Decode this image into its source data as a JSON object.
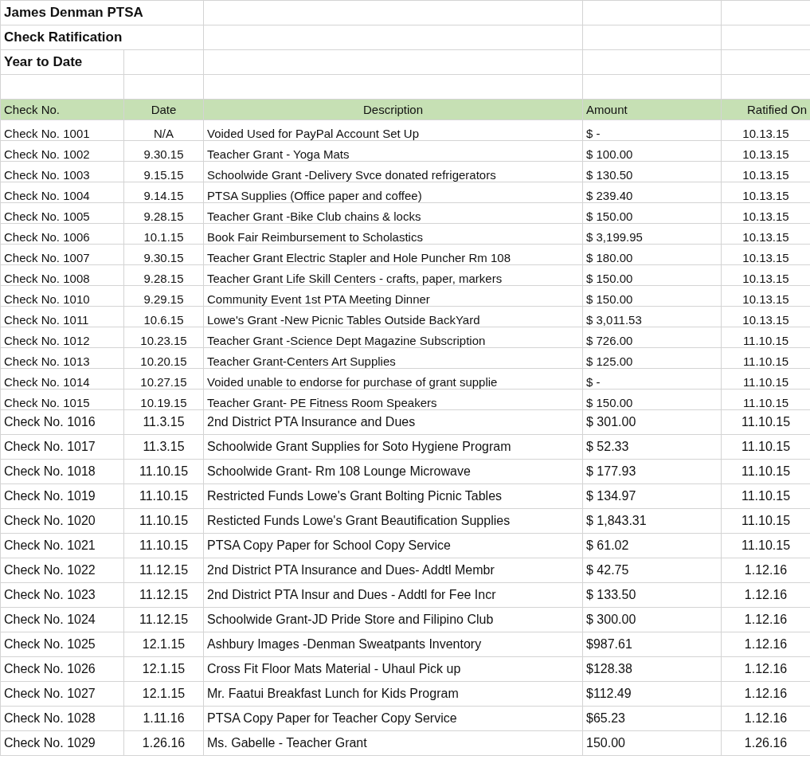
{
  "title_lines": [
    "James Denman PTSA",
    "Check Ratification",
    "Year to Date"
  ],
  "columns": [
    "Check No.",
    "Date",
    "Description",
    "Amount",
    "Ratified On"
  ],
  "rows": [
    {
      "check_no": "Check No. 1001",
      "date": "N/A",
      "description": "Voided  Used for PayPal Account Set Up",
      "amount": "$ -",
      "ratified_on": "10.13.15"
    },
    {
      "check_no": "Check No. 1002",
      "date": "9.30.15",
      "description": "Teacher Grant - Yoga Mats",
      "amount": "$ 100.00",
      "ratified_on": "10.13.15"
    },
    {
      "check_no": "Check No. 1003",
      "date": "9.15.15",
      "description": "Schoolwide Grant -Delivery  Svce donated refrigerators",
      "amount": "$ 130.50",
      "ratified_on": "10.13.15"
    },
    {
      "check_no": "Check No. 1004",
      "date": "9.14.15",
      "description": "PTSA Supplies (Office paper and coffee)",
      "amount": "$ 239.40",
      "ratified_on": "10.13.15"
    },
    {
      "check_no": "Check No. 1005",
      "date": "9.28.15",
      "description": "Teacher Grant -Bike Club  chains & locks",
      "amount": "$ 150.00",
      "ratified_on": "10.13.15"
    },
    {
      "check_no": "Check No. 1006",
      "date": "10.1.15",
      "description": "Book Fair Reimbursement to Scholastics",
      "amount": "$ 3,199.95",
      "ratified_on": "10.13.15"
    },
    {
      "check_no": "Check No. 1007",
      "date": "9.30.15",
      "description": "Teacher Grant Electric Stapler and Hole Puncher Rm 108",
      "amount": "$ 180.00",
      "ratified_on": "10.13.15"
    },
    {
      "check_no": "Check No. 1008",
      "date": "9.28.15",
      "description": "Teacher Grant Life Skill Centers - crafts,  paper, markers",
      "amount": "$ 150.00",
      "ratified_on": "10.13.15"
    },
    {
      "check_no": "Check No. 1010",
      "date": "9.29.15",
      "description": "Community Event 1st PTA Meeting Dinner",
      "amount": "$ 150.00",
      "ratified_on": "10.13.15"
    },
    {
      "check_no": "Check No. 1011",
      "date": "10.6.15",
      "description": "Lowe's Grant -New Picnic Tables Outside BackYard",
      "amount": "$ 3,011.53",
      "ratified_on": "10.13.15"
    },
    {
      "check_no": "Check No. 1012",
      "date": "10.23.15",
      "description": "Teacher Grant -Science Dept Magazine Subscription",
      "amount": "$ 726.00",
      "ratified_on": "11.10.15"
    },
    {
      "check_no": "Check No. 1013",
      "date": "10.20.15",
      "description": "Teacher Grant-Centers Art Supplies",
      "amount": "$ 125.00",
      "ratified_on": "11.10.15"
    },
    {
      "check_no": "Check No. 1014",
      "date": "10.27.15",
      "description": "Voided unable to endorse for purchase of grant supplie",
      "amount": "$ -",
      "ratified_on": "11.10.15"
    },
    {
      "check_no": "Check No. 1015",
      "date": "10.19.15",
      "description": "Teacher Grant- PE Fitness Room Speakers",
      "amount": "$ 150.00",
      "ratified_on": "11.10.15"
    },
    {
      "check_no": "Check No. 1016",
      "date": "11.3.15",
      "description": "2nd District PTA Insurance and Dues",
      "amount": "$ 301.00",
      "ratified_on": "11.10.15"
    },
    {
      "check_no": "Check No. 1017",
      "date": "11.3.15",
      "description": "Schoolwide Grant Supplies for Soto Hygiene Program",
      "amount": "$ 52.33",
      "ratified_on": "11.10.15"
    },
    {
      "check_no": "Check No. 1018",
      "date": "11.10.15",
      "description": "Schoolwide Grant- Rm 108 Lounge Microwave",
      "amount": "$ 177.93",
      "ratified_on": "11.10.15"
    },
    {
      "check_no": "Check No. 1019",
      "date": "11.10.15",
      "description": "Restricted Funds Lowe's Grant Bolting Picnic Tables",
      "amount": "$ 134.97",
      "ratified_on": "11.10.15"
    },
    {
      "check_no": "Check No. 1020",
      "date": "11.10.15",
      "description": "Resticted Funds Lowe's Grant Beautification Supplies",
      "amount": "$ 1,843.31",
      "ratified_on": "11.10.15"
    },
    {
      "check_no": "Check No. 1021",
      "date": "11.10.15",
      "description": "PTSA Copy Paper for School Copy Service",
      "amount": "$ 61.02",
      "ratified_on": "11.10.15"
    },
    {
      "check_no": "Check No. 1022",
      "date": "11.12.15",
      "description": "2nd District PTA Insurance and Dues- Addtl Membr",
      "amount": "$ 42.75",
      "ratified_on": "1.12.16"
    },
    {
      "check_no": "Check No. 1023",
      "date": "11.12.15",
      "description": "2nd District PTA Insur and Dues - Addtl for Fee Incr",
      "amount": "$ 133.50",
      "ratified_on": "1.12.16"
    },
    {
      "check_no": "Check No. 1024",
      "date": "11.12.15",
      "description": "Schoolwide Grant-JD Pride Store and Filipino Club",
      "amount": "$ 300.00",
      "ratified_on": "1.12.16"
    },
    {
      "check_no": "Check No. 1025",
      "date": "12.1.15",
      "description": "Ashbury Images -Denman Sweatpants Inventory",
      "amount": "$987.61",
      "ratified_on": "1.12.16"
    },
    {
      "check_no": "Check No. 1026",
      "date": "12.1.15",
      "description": "Cross Fit Floor Mats Material - Uhaul Pick up",
      "amount": "$128.38",
      "ratified_on": "1.12.16"
    },
    {
      "check_no": "Check No. 1027",
      "date": "12.1.15",
      "description": "Mr. Faatui Breakfast Lunch for Kids Program",
      "amount": "$112.49",
      "ratified_on": "1.12.16"
    },
    {
      "check_no": "Check No. 1028",
      "date": "1.11.16",
      "description": "PTSA Copy Paper for Teacher Copy Service",
      "amount": "$65.23",
      "ratified_on": "1.12.16"
    },
    {
      "check_no": "Check No. 1029",
      "date": "1.26.16",
      "description": "Ms. Gabelle - Teacher Grant",
      "amount": "150.00",
      "ratified_on": "1.26.16"
    }
  ]
}
